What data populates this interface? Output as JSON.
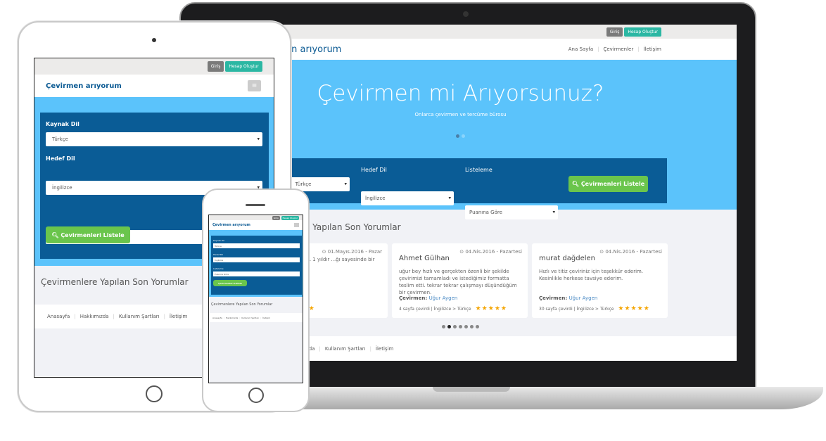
{
  "site": {
    "logo": "Çevirmen arıyorum",
    "login": "Giriş",
    "signup": "Hesap Oluştur",
    "nav": [
      "Ana Sayfa",
      "Çevirmenler",
      "İletişim"
    ],
    "hero_title": "Çevirmen mi Arıyorsunuz?",
    "hero_subtitle": "Onlarca çevirmen ve tercüme bürosu",
    "form": {
      "source_label": "Kaynak Dil",
      "source_value": "Türkçe",
      "target_label": "Hedef Dil",
      "target_value": "İngilizce",
      "sort_label": "Listeleme",
      "sort_value": "Puanına Göre",
      "submit": "Çevirmenleri Listele"
    },
    "reviews_title": "Çevirmenlere Yapılan Son Yorumlar",
    "reviews": [
      {
        "name": "",
        "date": "01.Mayıs.2016 - Pazar",
        "text": "...ka adres aramayın. 1 yıldır ...ğı sayesinde bir çok raporumu",
        "translator_label": "",
        "translator": "...oğlu",
        "meta": "...ngilizce",
        "stars": 5
      },
      {
        "name": "Ahmet Gülhan",
        "date": "04.Nis.2016 - Pazartesi",
        "text": "uğur bey hızlı ve gerçekten özenli bir şekilde çevirimizi tamamladı ve istediğimiz formatta teslim etti. tekrar tekrar çalışmayı düşündüğüm bir çevirmen.",
        "translator_label": "Çevirmen:",
        "translator": "Uğur Aygen",
        "meta": "4 sayfa çevirdi | İngilizce > Türkçe",
        "stars": 5
      },
      {
        "name": "murat dağdelen",
        "date": "04.Nis.2016 - Pazartesi",
        "text": "Hızlı ve titiz çeviriniz için teşekkür ederim. Kesinlikle herkese tavsiye ederim.",
        "translator_label": "Çevirmen:",
        "translator": "Uğur Aygen",
        "meta": "30 sayfa çevirdi | İngilizce > Türkçe",
        "stars": 5
      }
    ],
    "footer": [
      "Anasayfa",
      "Hakkımızda",
      "Kullanım Şartları",
      "İletişim"
    ],
    "hero_slides": {
      "count": 2,
      "active": 1
    },
    "review_pages": {
      "count": 7,
      "active": 2
    }
  },
  "colors": {
    "hero": "#5bc3fb",
    "panel": "#0a5c96",
    "button": "#6ac54c",
    "signup": "#2bb7a3",
    "stars": "#f5a500"
  }
}
